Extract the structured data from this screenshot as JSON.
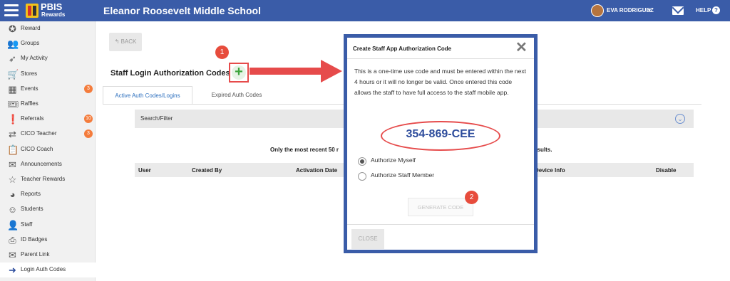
{
  "topbar": {
    "logo_text": "PBIS",
    "logo_sub": "Rewards",
    "school_name": "Eleanor Roosevelt Middle School",
    "user_name": "EVA RODRIGUEZ",
    "help_label": "HELP",
    "help_icon": "?",
    "user_caret": "▾",
    "colors": {
      "bar": "#3a5ca8"
    }
  },
  "sidebar": {
    "items": [
      {
        "label": "Reward",
        "icon": "reward-icon",
        "glyph": "✪"
      },
      {
        "label": "Groups",
        "icon": "groups-icon",
        "glyph": "👥"
      },
      {
        "label": "My Activity",
        "icon": "activity-icon",
        "glyph": "➶"
      },
      {
        "label": "Stores",
        "icon": "cart-icon",
        "glyph": "🛒"
      },
      {
        "label": "Events",
        "icon": "calendar-icon",
        "glyph": "▦",
        "badge": "3"
      },
      {
        "label": "Raffles",
        "icon": "ticket-icon",
        "glyph": "🎟"
      },
      {
        "label": "Referrals",
        "icon": "alert-icon",
        "glyph": "❗",
        "badge": "10"
      },
      {
        "label": "CICO Teacher",
        "icon": "swap-icon",
        "glyph": "⇄",
        "badge": "3"
      },
      {
        "label": "CICO Coach",
        "icon": "clipboard-icon",
        "glyph": "📋"
      },
      {
        "label": "Announcements",
        "icon": "envelope-icon",
        "glyph": "✉"
      },
      {
        "label": "Teacher Rewards",
        "icon": "star-icon",
        "glyph": "☆"
      },
      {
        "label": "Reports",
        "icon": "pie-chart-icon",
        "glyph": "◕"
      },
      {
        "label": "Students",
        "icon": "student-icon",
        "glyph": "☺"
      },
      {
        "label": "Staff",
        "icon": "person-icon",
        "glyph": "👤"
      },
      {
        "label": "ID Badges",
        "icon": "printer-icon",
        "glyph": "⎙"
      },
      {
        "label": "Parent Link",
        "icon": "mail-icon",
        "glyph": "✉"
      },
      {
        "label": "Login Auth Codes",
        "icon": "login-icon",
        "glyph": "➜",
        "active": true
      }
    ]
  },
  "main": {
    "back_label": "BACK",
    "back_glyph": "↰",
    "page_title": "Staff Login Authorization Codes",
    "add_glyph": "+",
    "step1": "1",
    "tabs": [
      {
        "label": "Active Auth Codes/Logins",
        "active": true
      },
      {
        "label": "Expired Auth Codes",
        "active": false
      }
    ],
    "filter_label": "Search/Filter",
    "filter_chevron": "⌄",
    "note_left": "Only the most recent 50 r",
    "note_right": "results.",
    "table_headers": [
      "User",
      "Created By",
      "Activation Date",
      "Device Info",
      "Disable"
    ]
  },
  "modal": {
    "title": "Create Staff App Authorization Code",
    "close_glyph": "✕",
    "body_text": "This is a one-time use code and must be entered within the next 4 hours or it will no longer be valid. Once entered this code allows the staff to have full access to the staff mobile app.",
    "code": "354-869-CEE",
    "radio_options": [
      {
        "label": "Authorize Myself",
        "checked": true
      },
      {
        "label": "Authorize Staff Member",
        "checked": false
      }
    ],
    "generate_label": "GENERATE CODE",
    "step2": "2",
    "close_label": "CLOSE"
  }
}
